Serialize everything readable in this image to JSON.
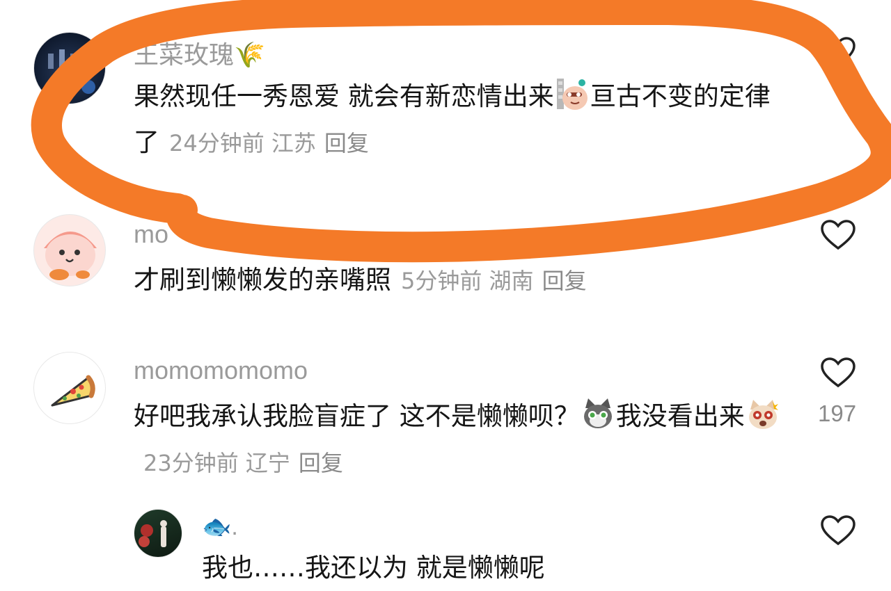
{
  "comments": [
    {
      "username": "王菜玫瑰🌾",
      "text_a": "果然现任一秀恩爱 就会有新恋情出来",
      "text_b": "亘古不变的定律了",
      "time": "24分钟前",
      "location": "江苏",
      "reply": "回复",
      "emoji": "peeking-face-emoji"
    },
    {
      "username": "mo",
      "text_a": "才刷到懒懒发的亲嘴照",
      "time": "5分钟前",
      "location": "湖南",
      "reply": "回复"
    },
    {
      "username": "momomomomo",
      "text_a": "好吧我承认我脸盲症了 这不是懒懒呗？",
      "text_b": "我没看出来",
      "time": "23分钟前",
      "location": "辽宁",
      "reply": "回复",
      "like_count": "197",
      "emoji_1": "cat-face-emoji",
      "emoji_2": "surprised-cat-emoji"
    },
    {
      "username": "🐟.",
      "text_a": "我也……我还以为 就是懒懒呢"
    }
  ],
  "annotation": {
    "color": "#F47A28"
  }
}
